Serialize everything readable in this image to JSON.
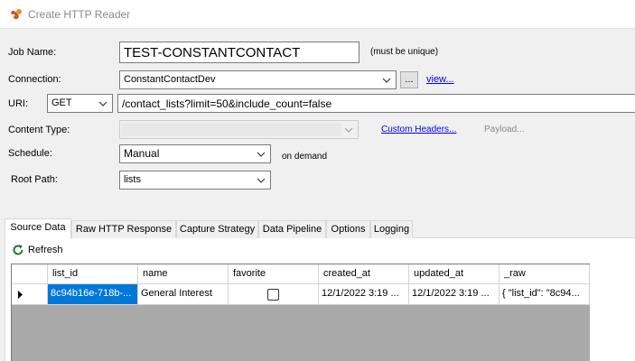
{
  "window": {
    "title": "Create HTTP Reader"
  },
  "form": {
    "job_name_label": "Job Name:",
    "job_name_value": "TEST-CONSTANTCONTACT",
    "job_name_hint": "(must be unique)",
    "connection_label": "Connection:",
    "connection_value": "ConstantContactDev",
    "browse_label": "...",
    "view_link": "view...",
    "uri_label": "URI:",
    "method_value": "GET",
    "uri_value": "/contact_lists?limit=50&include_count=false",
    "content_type_label": "Content Type:",
    "content_type_value": "",
    "custom_headers_link": "Custom Headers...",
    "payload_label": "Payload...",
    "schedule_label": "Schedule:",
    "schedule_value": "Manual",
    "schedule_hint": "on demand",
    "root_path_label": "Root Path:",
    "root_path_value": "lists"
  },
  "tabs": [
    "Source Data",
    "Raw HTTP Response",
    "Capture Strategy",
    "Data Pipeline",
    "Options",
    "Logging"
  ],
  "active_tab": "Source Data",
  "toolbar": {
    "refresh_label": "Refresh"
  },
  "grid": {
    "columns": [
      "list_id",
      "name",
      "favorite",
      "created_at",
      "updated_at",
      "_raw"
    ],
    "rows": [
      {
        "list_id": "8c94b16e-718b-...",
        "name": "General Interest",
        "favorite": false,
        "created_at": "12/1/2022 3:19 ...",
        "updated_at": "12/1/2022 3:19 ...",
        "_raw": "{  \"list_id\": \"8c94..."
      }
    ]
  },
  "colors": {
    "selection": "#0078d7",
    "link": "#0000ee",
    "grid_background": "#a9a9a9",
    "refresh_icon": "#1e7b34"
  },
  "icons": [
    "app-icon",
    "dropdown-arrow-icon",
    "refresh-icon",
    "row-pointer-icon"
  ]
}
